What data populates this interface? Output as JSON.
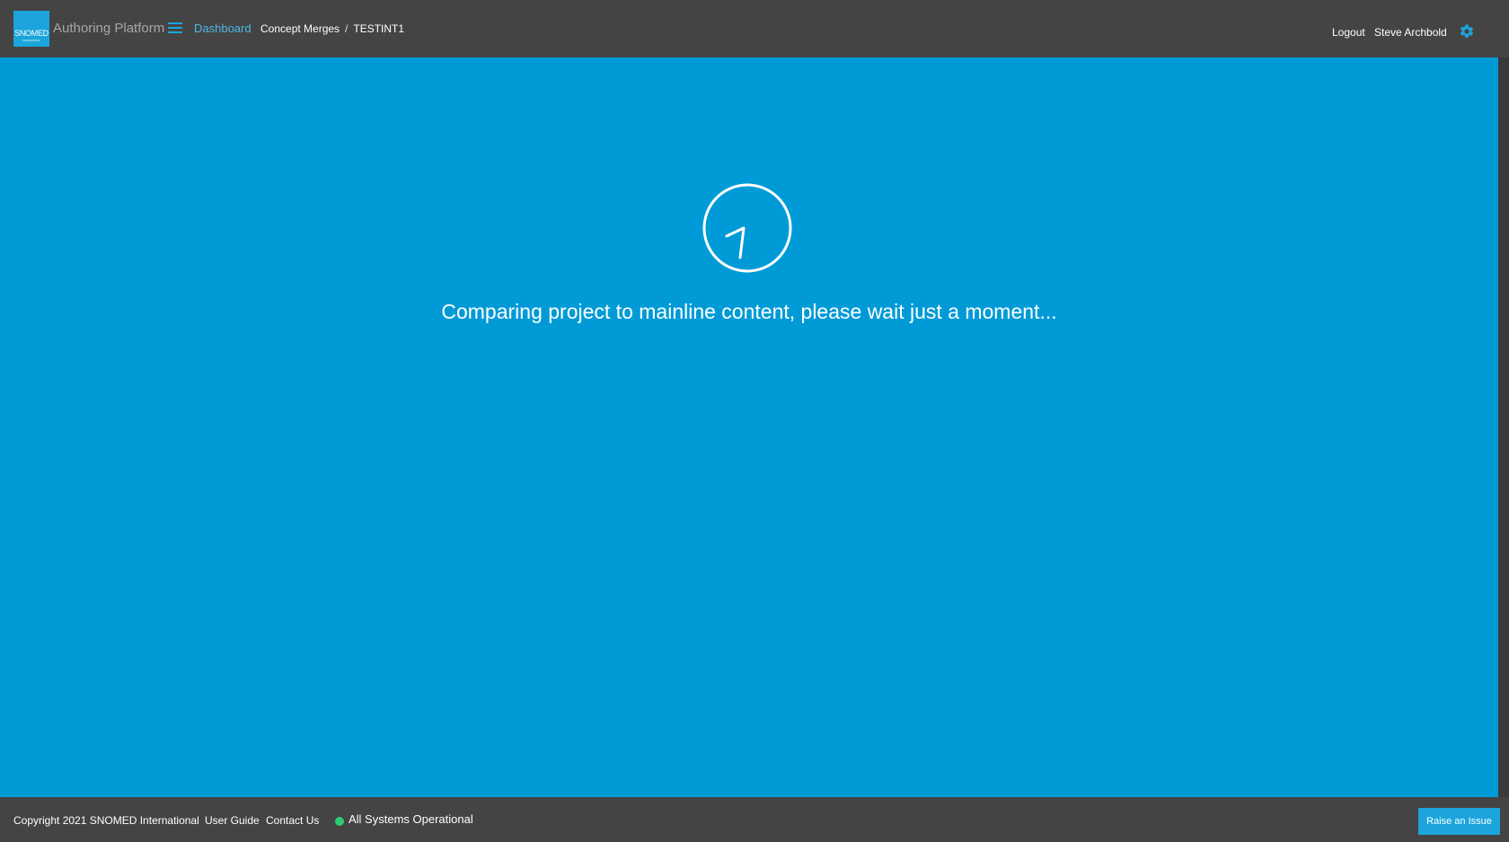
{
  "header": {
    "logo_text": "SNOMED",
    "logo_subtext": "INTERNATIONAL",
    "app_title": "Authoring Platform",
    "nav_dashboard": "Dashboard",
    "breadcrumb": [
      "Concept Merges",
      "TESTINT1"
    ],
    "breadcrumb_separator": "/",
    "logout": "Logout",
    "username": "Steve Archbold",
    "menu_icon": "hamburger-menu-icon",
    "settings_icon": "gear-icon"
  },
  "main": {
    "loading_message": "Comparing project to mainline content, please wait just a moment...",
    "spinner_icon": "loading-spinner-icon"
  },
  "footer": {
    "copyright": "Copyright 2021 SNOMED International",
    "user_guide": "User Guide",
    "contact_us": "Contact Us",
    "status": "All Systems Operational",
    "status_color": "#2ecc71",
    "raise_issue": "Raise an Issue"
  },
  "colors": {
    "header_bg": "#444444",
    "main_bg": "#009bd7",
    "accent": "#1ba5dc"
  }
}
